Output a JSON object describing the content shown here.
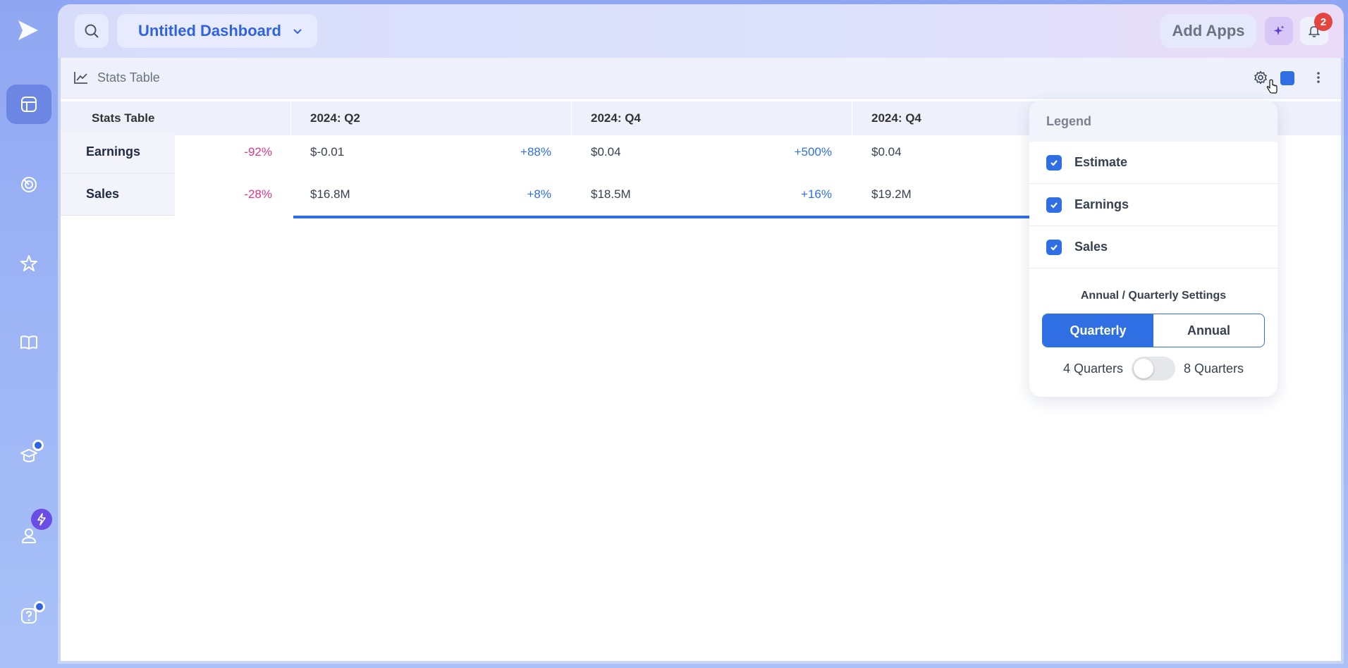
{
  "header": {
    "dashboard_title": "Untitled Dashboard",
    "add_apps_label": "Add Apps",
    "notification_count": "2"
  },
  "panel": {
    "title": "Stats Table"
  },
  "table": {
    "corner_label": "Stats Table",
    "columns": [
      "2024: Q2",
      "2024: Q4",
      "2024: Q4"
    ],
    "rows": [
      {
        "label": "Earnings",
        "change0": "-92%",
        "cells": [
          {
            "value": "$-0.01",
            "change": "+88%"
          },
          {
            "value": "$0.04",
            "change": "+500%"
          },
          {
            "value": "$0.04",
            "change": ""
          }
        ]
      },
      {
        "label": "Sales",
        "change0": "-28%",
        "cells": [
          {
            "value": "$16.8M",
            "change": "+8%"
          },
          {
            "value": "$18.5M",
            "change": "+16%"
          },
          {
            "value": "$19.2M",
            "change": ""
          }
        ]
      }
    ]
  },
  "legend": {
    "title": "Legend",
    "items": [
      {
        "label": "Estimate",
        "checked": true
      },
      {
        "label": "Earnings",
        "checked": true
      },
      {
        "label": "Sales",
        "checked": true
      }
    ],
    "settings_title": "Annual / Quarterly Settings",
    "segment": {
      "quarterly": "Quarterly",
      "annual": "Annual",
      "selected": "Quarterly"
    },
    "toggle": {
      "left_label": "4 Quarters",
      "right_label": "8 Quarters",
      "on": false
    }
  },
  "colors": {
    "accent": "#2f6fe3",
    "negative": "#e0338b",
    "badge": "#e4463f"
  }
}
